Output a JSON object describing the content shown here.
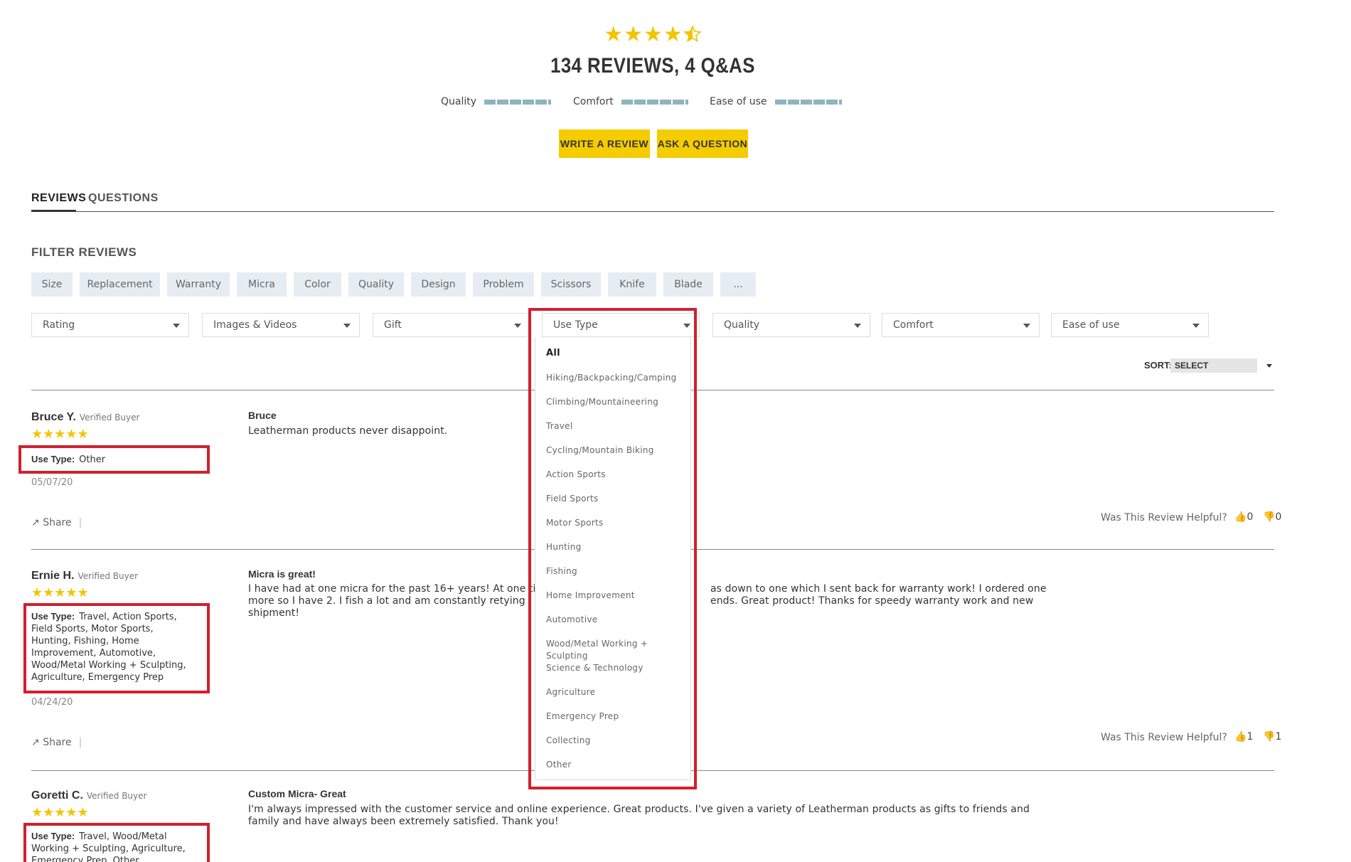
{
  "summary": {
    "rating": 4.5,
    "stars_full": "★★★★",
    "title": "134 REVIEWS, 4 Q&AS",
    "bars": [
      {
        "label": "Quality",
        "value": 1.0
      },
      {
        "label": "Comfort",
        "value": 1.0
      },
      {
        "label": "Ease of use",
        "value": 1.0
      }
    ],
    "write_review_label": "WRITE A REVIEW",
    "ask_question_label": "ASK A QUESTION"
  },
  "tabs": [
    {
      "label": "REVIEWS",
      "active": true
    },
    {
      "label": "QUESTIONS",
      "active": false
    }
  ],
  "filter": {
    "title": "FILTER REVIEWS",
    "chips": [
      "Size",
      "Replacement",
      "Warranty",
      "Micra",
      "Color",
      "Quality",
      "Design",
      "Problem",
      "Scissors",
      "Knife",
      "Blade",
      "..."
    ],
    "selects": [
      "Rating",
      "Images & Videos",
      "Gift",
      "Use Type",
      "Quality",
      "Comfort",
      "Ease of use"
    ]
  },
  "use_type_dropdown": {
    "options": [
      "All",
      "Hiking/Backpacking/Camping",
      "Climbing/Mountaineering",
      "Travel",
      "Cycling/Mountain Biking",
      "Action Sports",
      "Field Sports",
      "Motor Sports",
      "Hunting",
      "Fishing",
      "Home Improvement",
      "Automotive",
      "Wood/Metal Working + Sculpting",
      "Science & Technology",
      "Agriculture",
      "Emergency Prep",
      "Collecting",
      "Other"
    ]
  },
  "sort": {
    "label": "SORT:",
    "value": "SELECT"
  },
  "reviews": [
    {
      "name": "Bruce Y.",
      "verified": "Verified Buyer",
      "stars": "★★★★★",
      "use_type_label": "Use Type:",
      "use_type": "Other",
      "date": "05/07/20",
      "share": "Share",
      "title": "Bruce",
      "body": "Leatherman products never disappoint.",
      "helpful_label": "Was This Review Helpful?",
      "up": "0",
      "down": "0"
    },
    {
      "name": "Ernie H.",
      "verified": "Verified Buyer",
      "stars": "★★★★★",
      "use_type_label": "Use Type:",
      "use_type_lines": [
        "Travel, Action Sports,",
        "Field Sports, Motor Sports,",
        "Hunting, Fishing, Home",
        "Improvement, Automotive,",
        "Wood/Metal Working + Sculpting,",
        "Agriculture, Emergency Prep"
      ],
      "date": "04/24/20",
      "share": "Share",
      "title": "Micra is great!",
      "body_lines": [
        "I have had at one micra for the past 16+ years! At one ti",
        "more so I have 2. I fish a lot and am constantly retying",
        "shipment!"
      ],
      "body_right_lines": [
        "as down to one which I sent back for warranty work! I ordered one",
        "ends. Great product! Thanks for speedy warranty work and new"
      ],
      "helpful_label": "Was This Review Helpful?",
      "up": "1",
      "down": "1"
    },
    {
      "name": "Goretti C.",
      "verified": "Verified Buyer",
      "stars": "★★★★★",
      "use_type_label": "Use Type:",
      "use_type_lines": [
        "Travel, Wood/Metal",
        "Working + Sculpting, Agriculture,",
        "Emergency Prep, Other"
      ],
      "title": "Custom Micra- Great",
      "body_lines": [
        "I'm always impressed with the customer service and online experience. Great products. I've given a variety of Leatherman products as gifts to friends and",
        "family and have always been extremely satisfied. Thank you!"
      ]
    }
  ]
}
